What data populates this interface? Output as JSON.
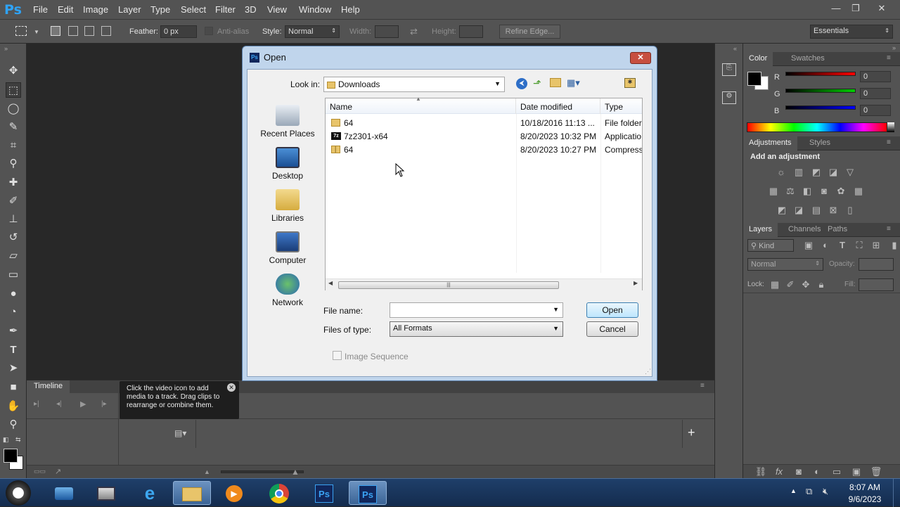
{
  "app": {
    "logo": "Ps"
  },
  "menu": [
    "File",
    "Edit",
    "Image",
    "Layer",
    "Type",
    "Select",
    "Filter",
    "3D",
    "View",
    "Window",
    "Help"
  ],
  "window_controls": {
    "minimize": "—",
    "restore": "❐",
    "close": "✕"
  },
  "options_bar": {
    "feather_label": "Feather:",
    "feather_value": "0 px",
    "antialias_label": "Anti-alias",
    "style_label": "Style:",
    "style_value": "Normal",
    "width_label": "Width:",
    "height_label": "Height:",
    "refine_edge": "Refine Edge...",
    "workspace": "Essentials"
  },
  "color_panel": {
    "tabs": [
      "Color",
      "Swatches"
    ],
    "r_label": "R",
    "g_label": "G",
    "b_label": "B",
    "r_value": "0",
    "g_value": "0",
    "b_value": "0"
  },
  "adjustments_panel": {
    "tabs": [
      "Adjustments",
      "Styles"
    ],
    "heading": "Add an adjustment"
  },
  "layers_panel": {
    "tabs": [
      "Layers",
      "Channels",
      "Paths"
    ],
    "kind_label": "Kind",
    "blend_mode": "Normal",
    "opacity_label": "Opacity:",
    "lock_label": "Lock:",
    "fill_label": "Fill:"
  },
  "timeline": {
    "title": "Timeline",
    "tooltip": "Click the video icon to add media to a track. Drag clips to rearrange or combine them.",
    "add_label": "+"
  },
  "dialog": {
    "title": "Open",
    "look_in_label": "Look in:",
    "look_in_value": "Downloads",
    "places": [
      "Recent Places",
      "Desktop",
      "Libraries",
      "Computer",
      "Network"
    ],
    "columns": [
      "Name",
      "Date modified",
      "Type"
    ],
    "files": [
      {
        "name": "64",
        "date": "10/18/2016 11:13 ...",
        "type": "File folder",
        "icon": "folder-icon"
      },
      {
        "name": "7z2301-x64",
        "date": "8/20/2023 10:32 PM",
        "type": "Applicatio",
        "icon": "7z-app-icon"
      },
      {
        "name": "64",
        "date": "8/20/2023 10:27 PM",
        "type": "Compresse",
        "icon": "zip-folder-icon"
      }
    ],
    "file_name_label": "File name:",
    "file_name_value": "",
    "files_of_type_label": "Files of type:",
    "files_of_type_value": "All Formats",
    "open_button": "Open",
    "cancel_button": "Cancel",
    "image_sequence_label": "Image Sequence"
  },
  "taskbar": {
    "time": "8:07 AM",
    "date": "9/6/2023"
  }
}
